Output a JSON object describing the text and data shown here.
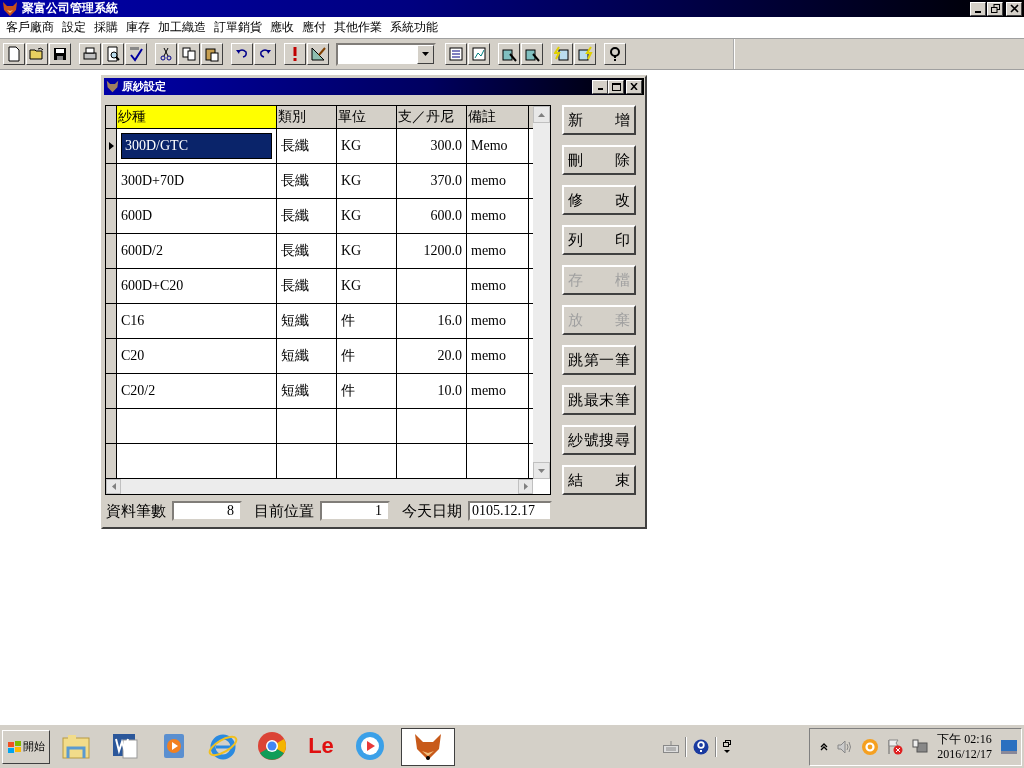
{
  "app": {
    "title": "聚富公司管理系統"
  },
  "menu": [
    {
      "label": "客戶廠商"
    },
    {
      "label": "設定"
    },
    {
      "label": "採購"
    },
    {
      "label": "庫存"
    },
    {
      "label": "加工織造"
    },
    {
      "label": "訂單銷貨"
    },
    {
      "label": "應收"
    },
    {
      "label": "應付"
    },
    {
      "label": "其他作業"
    },
    {
      "label": "系統功能"
    }
  ],
  "child_window": {
    "title": "原紗設定",
    "columns": [
      {
        "label": "紗種",
        "selected": true
      },
      {
        "label": "類別",
        "selected": false
      },
      {
        "label": "單位",
        "selected": false
      },
      {
        "label": "支／丹尼",
        "selected": false
      },
      {
        "label": "備註",
        "selected": false
      }
    ],
    "rows": [
      {
        "selected": true,
        "cells": [
          "300D/GTC",
          "長纖",
          "KG",
          "300.0",
          "Memo"
        ]
      },
      {
        "selected": false,
        "cells": [
          "300D+70D",
          "長纖",
          "KG",
          "370.0",
          "memo"
        ]
      },
      {
        "selected": false,
        "cells": [
          "600D",
          "長纖",
          "KG",
          "600.0",
          "memo"
        ]
      },
      {
        "selected": false,
        "cells": [
          "600D/2",
          "長纖",
          "KG",
          "1200.0",
          "memo"
        ]
      },
      {
        "selected": false,
        "cells": [
          "600D+C20",
          "長纖",
          "KG",
          "",
          "memo"
        ]
      },
      {
        "selected": false,
        "cells": [
          "C16",
          "短纖",
          "件",
          "16.0",
          "memo"
        ]
      },
      {
        "selected": false,
        "cells": [
          "C20",
          "短纖",
          "件",
          "20.0",
          "memo"
        ]
      },
      {
        "selected": false,
        "cells": [
          "C20/2",
          "短纖",
          "件",
          "10.0",
          "memo"
        ]
      }
    ],
    "buttons": [
      {
        "label": "新增",
        "disabled": false
      },
      {
        "label": "刪除",
        "disabled": false
      },
      {
        "label": "修改",
        "disabled": false
      },
      {
        "label": "列印",
        "disabled": false
      },
      {
        "label": "存檔",
        "disabled": true
      },
      {
        "label": "放棄",
        "disabled": true
      },
      {
        "label": "跳第一筆",
        "disabled": false
      },
      {
        "label": "跳最末筆",
        "disabled": false
      },
      {
        "label": "紗號搜尋",
        "disabled": false
      },
      {
        "label": "結束",
        "disabled": false
      }
    ],
    "footer": [
      {
        "label": "資料筆數",
        "value": "8"
      },
      {
        "label": "目前位置",
        "value": "1"
      },
      {
        "label": "今天日期",
        "value": "0105.12.17"
      }
    ]
  },
  "taskbar": {
    "start": "開始",
    "apps": [
      {
        "kind": "folder",
        "active": false
      },
      {
        "kind": "word",
        "active": false
      },
      {
        "kind": "media",
        "active": false
      },
      {
        "kind": "ie",
        "active": false
      },
      {
        "kind": "chrome",
        "active": false
      },
      {
        "kind": "text-logo",
        "label": "Le",
        "active": false
      },
      {
        "kind": "player",
        "active": false
      },
      {
        "kind": "fox",
        "active": true
      }
    ],
    "clock": {
      "time": "下午 02:16",
      "date": "2016/12/17"
    }
  }
}
